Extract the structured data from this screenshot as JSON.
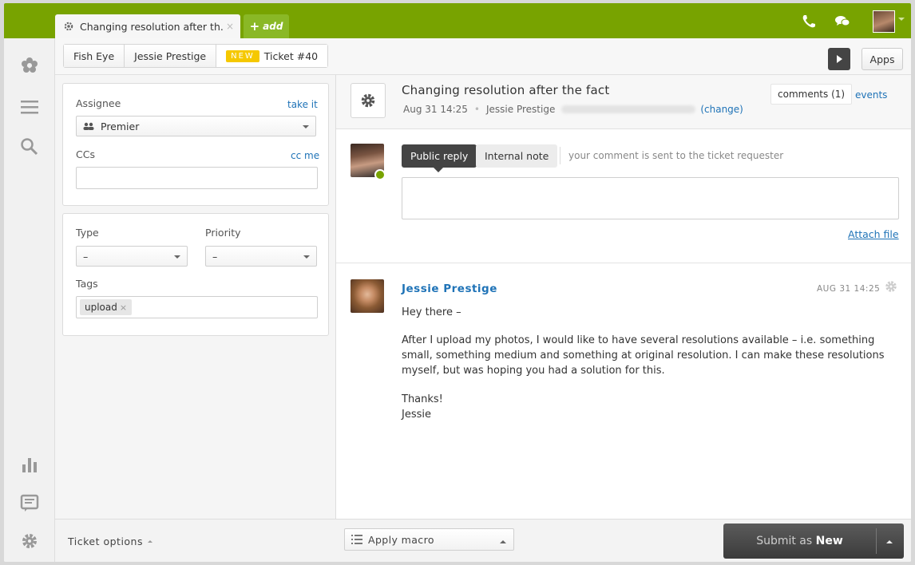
{
  "topbar": {
    "tab_title": "Changing resolution after th...",
    "tab_close": "×",
    "add_label": "add",
    "add_plus": "+",
    "colors": {
      "brand_green": "#78a300",
      "add_green": "#8ab826"
    },
    "icons": [
      "phone-icon",
      "chat-icon",
      "user-avatar"
    ]
  },
  "sidebar": {
    "icons": [
      "zendesk-logo-icon",
      "menu-icon",
      "search-icon",
      "reports-icon",
      "views-icon",
      "admin-gear-icon"
    ]
  },
  "breadcrumbs": {
    "org": "Fish Eye",
    "requester": "Jessie Prestige",
    "status_badge": "NEW",
    "ticket": "Ticket #40"
  },
  "toolbar": {
    "apps_label": "Apps"
  },
  "properties": {
    "assignee_label": "Assignee",
    "take_it": "take it",
    "assignee_value": "Premier",
    "ccs_label": "CCs",
    "cc_me": "cc me",
    "type_label": "Type",
    "type_value": "–",
    "priority_label": "Priority",
    "priority_value": "–",
    "tags_label": "Tags",
    "tags": [
      "upload"
    ],
    "tag_remove": "×"
  },
  "ticket": {
    "title": "Changing resolution after the fact",
    "date": "Aug 31 14:25",
    "requester": "Jessie Prestige",
    "change": "(change)",
    "comments_tab": "comments (1)",
    "events_tab": "events"
  },
  "reply": {
    "public_reply": "Public reply",
    "internal_note": "Internal note",
    "hint": "your comment is sent to the ticket requester",
    "attach_file": "Attach file"
  },
  "comment": {
    "author": "Jessie Prestige",
    "date": "AUG 31 14:25",
    "greeting": "Hey there –",
    "body": "After I upload my photos, I would like to have several resolutions available – i.e. something small, something medium and something at original resolution. I can make these resolutions myself, but was hoping you had a solution for this.",
    "thanks": "Thanks!",
    "signature": "Jessie"
  },
  "footer": {
    "ticket_options": "Ticket options",
    "apply_macro": "Apply macro",
    "submit_prefix": "Submit as",
    "submit_status": "New"
  }
}
